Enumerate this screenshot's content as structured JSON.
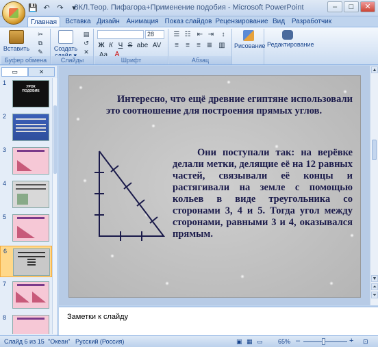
{
  "window": {
    "title": "8КЛ.Теор. Пифагора+Применение подобия - Microsoft PowerPoint",
    "controls": [
      "–",
      "□",
      "✕"
    ]
  },
  "qat": {
    "save": "💾",
    "undo": "↶",
    "redo": "↷",
    "more": "▾"
  },
  "ribbon": {
    "tabs": [
      "Главная",
      "Вставка",
      "Дизайн",
      "Анимация",
      "Показ слайдов",
      "Рецензирование",
      "Вид",
      "Разработчик"
    ],
    "active_tab": "Главная",
    "groups": {
      "clipboard": {
        "label": "Буфер обмена",
        "paste": "Вставить"
      },
      "slides": {
        "label": "Слайды",
        "new_slide": "Создать слайд ▾"
      },
      "font": {
        "label": "Шрифт",
        "size": "28",
        "bold": "Ж",
        "italic": "К",
        "underline": "Ч",
        "strike": "S",
        "shadow": "abe",
        "spacing": "AV",
        "case": "Aa",
        "color": "A"
      },
      "paragraph": {
        "label": "Абзац"
      },
      "drawing": {
        "label": "Рисование"
      },
      "editing": {
        "label": "Редактирование"
      }
    }
  },
  "left_panel": {
    "tabs": [
      "▭",
      "✕"
    ],
    "thumbnails": [
      {
        "num": "1",
        "title": "УРОК",
        "subtitle": "ПОДОБИЕ"
      },
      {
        "num": "2"
      },
      {
        "num": "3"
      },
      {
        "num": "4"
      },
      {
        "num": "5"
      },
      {
        "num": "6"
      },
      {
        "num": "7"
      },
      {
        "num": "8"
      }
    ],
    "selected": "6"
  },
  "slide": {
    "paragraph1": "Интересно, что ещё древние египтяне использовали это соотношение для построения прямых углов.",
    "paragraph2": "Они поступали так: на верёвке делали метки, делящие её на 12 равных частей, связывали её концы и растягивали на земле с помощью кольев в виде треугольника со сторонами 3, 4 и 5. Тогда угол между сторонами, равными 3 и 4, оказывался прямым."
  },
  "notes": {
    "text": "Заметки к слайду"
  },
  "status": {
    "slide_counter": "Слайд 6 из 15",
    "theme": "\"Океан\"",
    "language": "Русский (Россия)",
    "zoom": "65%",
    "zoom_minus": "–",
    "zoom_plus": "+"
  },
  "colors": {
    "slide_text": "#1a1a4a",
    "triangle": "#1a1a4a",
    "selection": "#ffd88a"
  }
}
